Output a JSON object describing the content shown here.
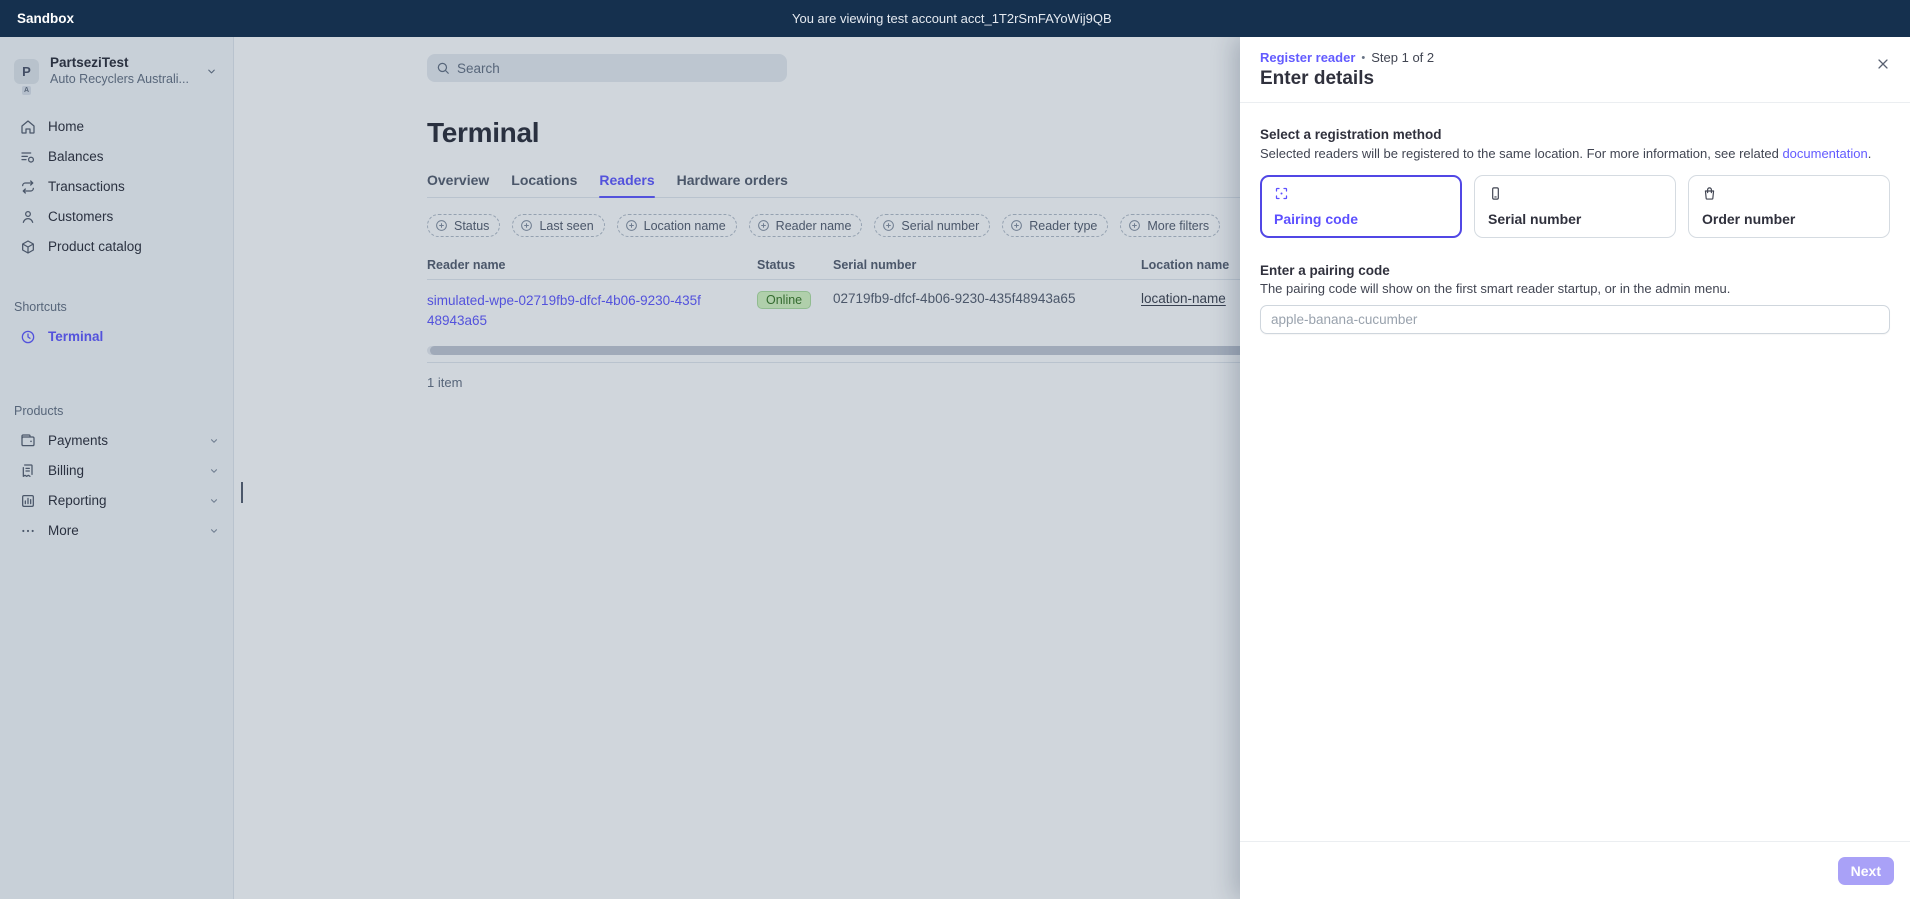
{
  "topbar": {
    "mode_label": "Sandbox",
    "notice": "You are viewing test account acct_1T2rSmFAYoWij9QB"
  },
  "sidebar": {
    "account": {
      "initial": "P",
      "sub_badge": "A",
      "name": "PartseziTest",
      "subtitle": "Auto Recyclers Australi..."
    },
    "nav": [
      {
        "label": "Home"
      },
      {
        "label": "Balances"
      },
      {
        "label": "Transactions"
      },
      {
        "label": "Customers"
      },
      {
        "label": "Product catalog"
      }
    ],
    "shortcuts_label": "Shortcuts",
    "shortcut_terminal": "Terminal",
    "products_label": "Products",
    "products": [
      {
        "label": "Payments"
      },
      {
        "label": "Billing"
      },
      {
        "label": "Reporting"
      },
      {
        "label": "More"
      }
    ]
  },
  "main": {
    "search_placeholder": "Search",
    "page_title": "Terminal",
    "tabs": [
      {
        "label": "Overview"
      },
      {
        "label": "Locations"
      },
      {
        "label": "Readers"
      },
      {
        "label": "Hardware orders"
      }
    ],
    "filters": [
      "Status",
      "Last seen",
      "Location name",
      "Reader name",
      "Serial number",
      "Reader type",
      "More filters"
    ],
    "table": {
      "columns": [
        "Reader name",
        "Status",
        "Serial number",
        "Location name"
      ],
      "rows": [
        {
          "reader_name": "simulated-wpe-02719fb9-dfcf-4b06-9230-435f48943a65",
          "status": "Online",
          "serial_number": "02719fb9-dfcf-4b06-9230-435f48943a65",
          "location_name": "location-name"
        }
      ],
      "summary": "1 item"
    }
  },
  "drawer": {
    "breadcrumb": "Register reader",
    "separator": "•",
    "step": "Step 1 of 2",
    "title": "Enter details",
    "method_section": {
      "heading": "Select a registration method",
      "description_prefix": "Selected readers will be registered to the same location. For more information, see related ",
      "description_link": "documentation",
      "description_suffix": "."
    },
    "methods": [
      {
        "label": "Pairing code"
      },
      {
        "label": "Serial number"
      },
      {
        "label": "Order number"
      }
    ],
    "pairing": {
      "heading": "Enter a pairing code",
      "description": "The pairing code will show on the first smart reader startup, or in the admin menu.",
      "input_placeholder": "apple-banana-cucumber"
    },
    "next_label": "Next"
  },
  "colors": {
    "accent": "#635bff",
    "selected_card_border": "#5147e5",
    "topbar_bg": "#15304e",
    "online_badge_bg": "#d7f7c2",
    "next_button_bg": "#a9a1f7"
  }
}
